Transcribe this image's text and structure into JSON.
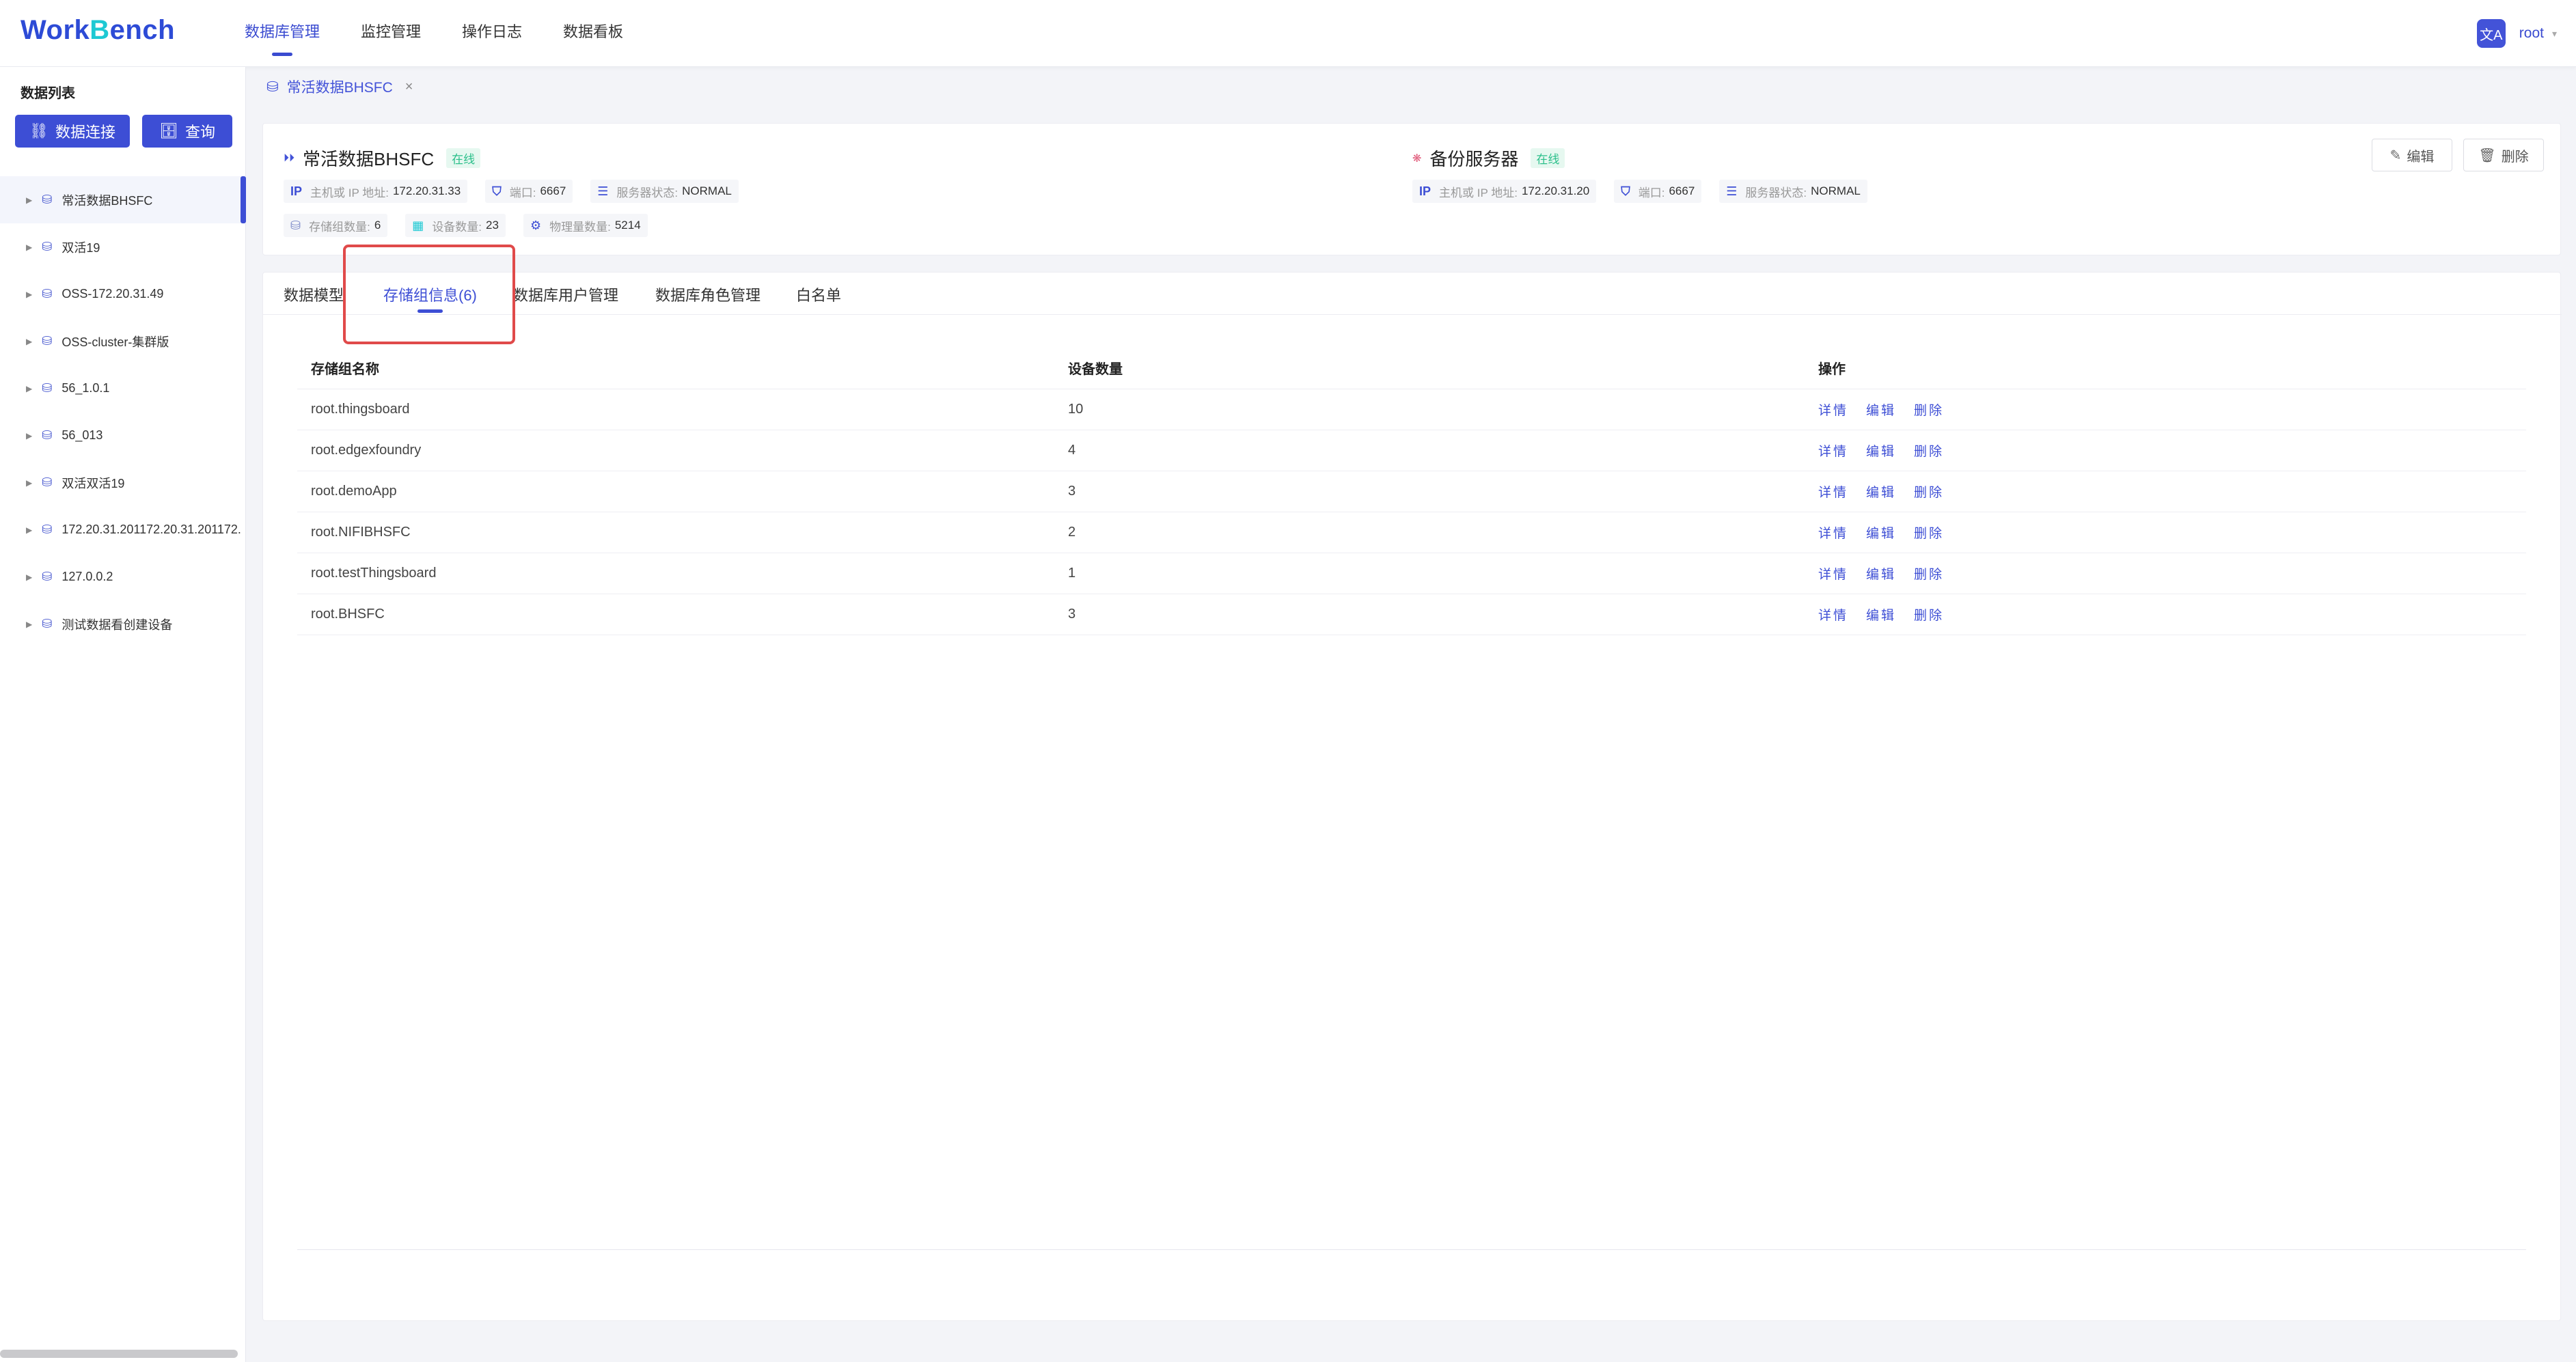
{
  "app": {
    "logo_w": "W",
    "logo_ork": "ork",
    "logo_b": "B",
    "logo_ench": "ench",
    "nav": [
      "数据库管理",
      "监控管理",
      "操作日志",
      "数据看板"
    ],
    "lang_icon": "文A",
    "user": "root"
  },
  "sidebar": {
    "title": "数据列表",
    "connect_label": "数据连接",
    "query_label": "查询",
    "items": [
      "常活数据BHSFC",
      "双活19",
      "OSS-172.20.31.49",
      "OSS-cluster-集群版",
      "56_1.0.1",
      "56_013",
      "双活双活19",
      "172.20.31.201172.20.31.201172.",
      "127.0.0.2",
      "测试数据看创建设备"
    ]
  },
  "crumb": {
    "label": "常活数据BHSFC",
    "close": "×"
  },
  "primary": {
    "name": "常活数据BHSFC",
    "status": "在线",
    "ip_label": "主机或 IP 地址:",
    "ip": "172.20.31.33",
    "port_label": "端口:",
    "port": "6667",
    "svc_label": "服务器状态:",
    "svc": "NORMAL",
    "sg_label": "存储组数量:",
    "sg": "6",
    "dev_label": "设备数量:",
    "dev": "23",
    "phy_label": "物理量数量:",
    "phy": "5214"
  },
  "backup": {
    "name": "备份服务器",
    "status": "在线",
    "ip_label": "主机或 IP 地址:",
    "ip": "172.20.31.20",
    "port_label": "端口:",
    "port": "6667",
    "svc_label": "服务器状态:",
    "svc": "NORMAL"
  },
  "actions": {
    "edit": "编辑",
    "delete": "删除"
  },
  "tabs": [
    "数据模型",
    "存储组信息(6)",
    "数据库用户管理",
    "数据库角色管理",
    "白名单"
  ],
  "table": {
    "headers": [
      "存储组名称",
      "设备数量",
      "操作"
    ],
    "rows": [
      [
        "root.thingsboard",
        "10"
      ],
      [
        "root.edgexfoundry",
        "4"
      ],
      [
        "root.demoApp",
        "3"
      ],
      [
        "root.NIFIBHSFC",
        "2"
      ],
      [
        "root.testThingsboard",
        "1"
      ],
      [
        "root.BHSFC",
        "3"
      ]
    ],
    "ops": [
      "详情",
      "编辑",
      "删除"
    ]
  },
  "colors": {
    "primary": "#3d4ed5",
    "accent": "#1ec9d3",
    "online": "#2bbf8a",
    "highlight": "#e04a4a"
  }
}
